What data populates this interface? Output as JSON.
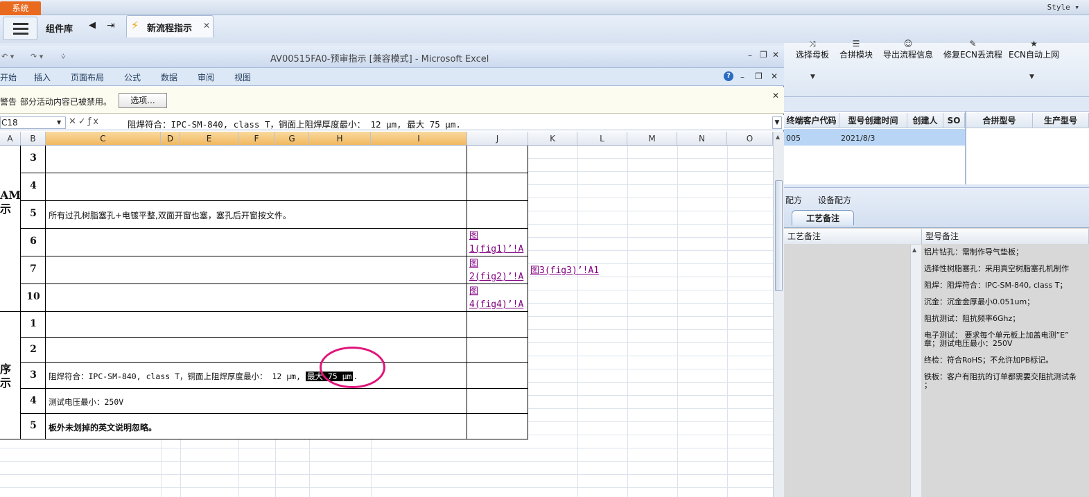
{
  "host": {
    "system_tab": "系统",
    "style_menu": "Style ▾",
    "component_library": "组件库",
    "flow_tab_label": "新流程指示",
    "toolbar": [
      {
        "label": "选择母板",
        "icon": "shuffle-icon",
        "glyph": "⤨"
      },
      {
        "label": "合拼模块",
        "icon": "list-icon",
        "glyph": "☰"
      },
      {
        "label": "导出流程信息",
        "icon": "smile-icon",
        "glyph": "☺"
      },
      {
        "label": "修复ECN丢流程",
        "icon": "wrench-icon",
        "glyph": "✎"
      },
      {
        "label": "ECN自动上网",
        "icon": "star-icon",
        "glyph": "★"
      }
    ]
  },
  "right_grid": {
    "headers": [
      "终端客户代码",
      "型号创建时间",
      "创建人",
      "SO",
      "合拼型号",
      "生产型号"
    ],
    "row": {
      "customer_code": "005",
      "created": "2021/8/3"
    }
  },
  "recipe_tabs": {
    "tabs": [
      "配方",
      "设备配方"
    ],
    "active": "工艺备注",
    "col_process": "工艺备注",
    "col_model": "型号备注",
    "notes": [
      "铝片钻孔：需制作导气垫板；",
      "选择性树脂塞孔：采用真空树脂塞孔机制作",
      "阻焊：阻焊符合：IPC-SM-840, class T；",
      "沉金：沉金金厚最小0.051um；",
      "阻抗测试：阻抗频率6Ghz；",
      "电子测试： 要求每个单元板上加盖电测”E”",
      "章；测试电压最小：250V",
      "终检：符合RoHS；不允许加PB标记。",
      "铁板：客户有阻抗的订单都需要交阻抗测试条",
      "；"
    ]
  },
  "excel": {
    "title": "AV00515FA0-预审指示  [兼容模式] - Microsoft Excel",
    "ribbon_tabs": [
      "开始",
      "插入",
      "页面布局",
      "公式",
      "数据",
      "审阅",
      "视图"
    ],
    "security_prefix": "警告",
    "security_msg": "部分活动内容已被禁用。",
    "options_button": "选项...",
    "name_box": "C18",
    "formula": "阻焊符合：IPC-SM-840, class T，铜面上阻焊厚度最小： 12 μm, 最大 75 μm.",
    "columns": [
      "A",
      "B",
      "C",
      "D",
      "E",
      "F",
      "G",
      "H",
      "I",
      "J",
      "K",
      "L",
      "M",
      "N",
      "O"
    ],
    "section1_label": [
      "AM",
      "示"
    ],
    "section2_label": [
      "序",
      "示"
    ],
    "rows_s1": [
      {
        "num": "3",
        "text": ""
      },
      {
        "num": "4",
        "text": ""
      },
      {
        "num": "5",
        "text": "所有过孔树脂塞孔+电镀平整,双面开窗也塞，塞孔后开窗按文件。"
      },
      {
        "num": "6",
        "text": ""
      },
      {
        "num": "7",
        "text": ""
      },
      {
        "num": "10",
        "text": ""
      }
    ],
    "links": {
      "fig1": [
        "图",
        "1(fig1)’!A"
      ],
      "fig2": [
        "图",
        "2(fig2)’!A"
      ],
      "fig4": [
        "图",
        "4(fig4)’!A"
      ],
      "fig3": "图3(fig3)’!A1"
    },
    "rows_s2": [
      {
        "num": "1",
        "text": ""
      },
      {
        "num": "2",
        "text": ""
      },
      {
        "num": "3",
        "text_before": "阻焊符合：IPC-SM-840, class T，铜面上阻焊厚度最小： 12 μm, ",
        "text_highlight": "最大 75 μm",
        "text_after": "."
      },
      {
        "num": "4",
        "text": "测试电压最小：250V"
      },
      {
        "num": "5",
        "text": "板外未划掉的英文说明忽略。"
      }
    ]
  }
}
